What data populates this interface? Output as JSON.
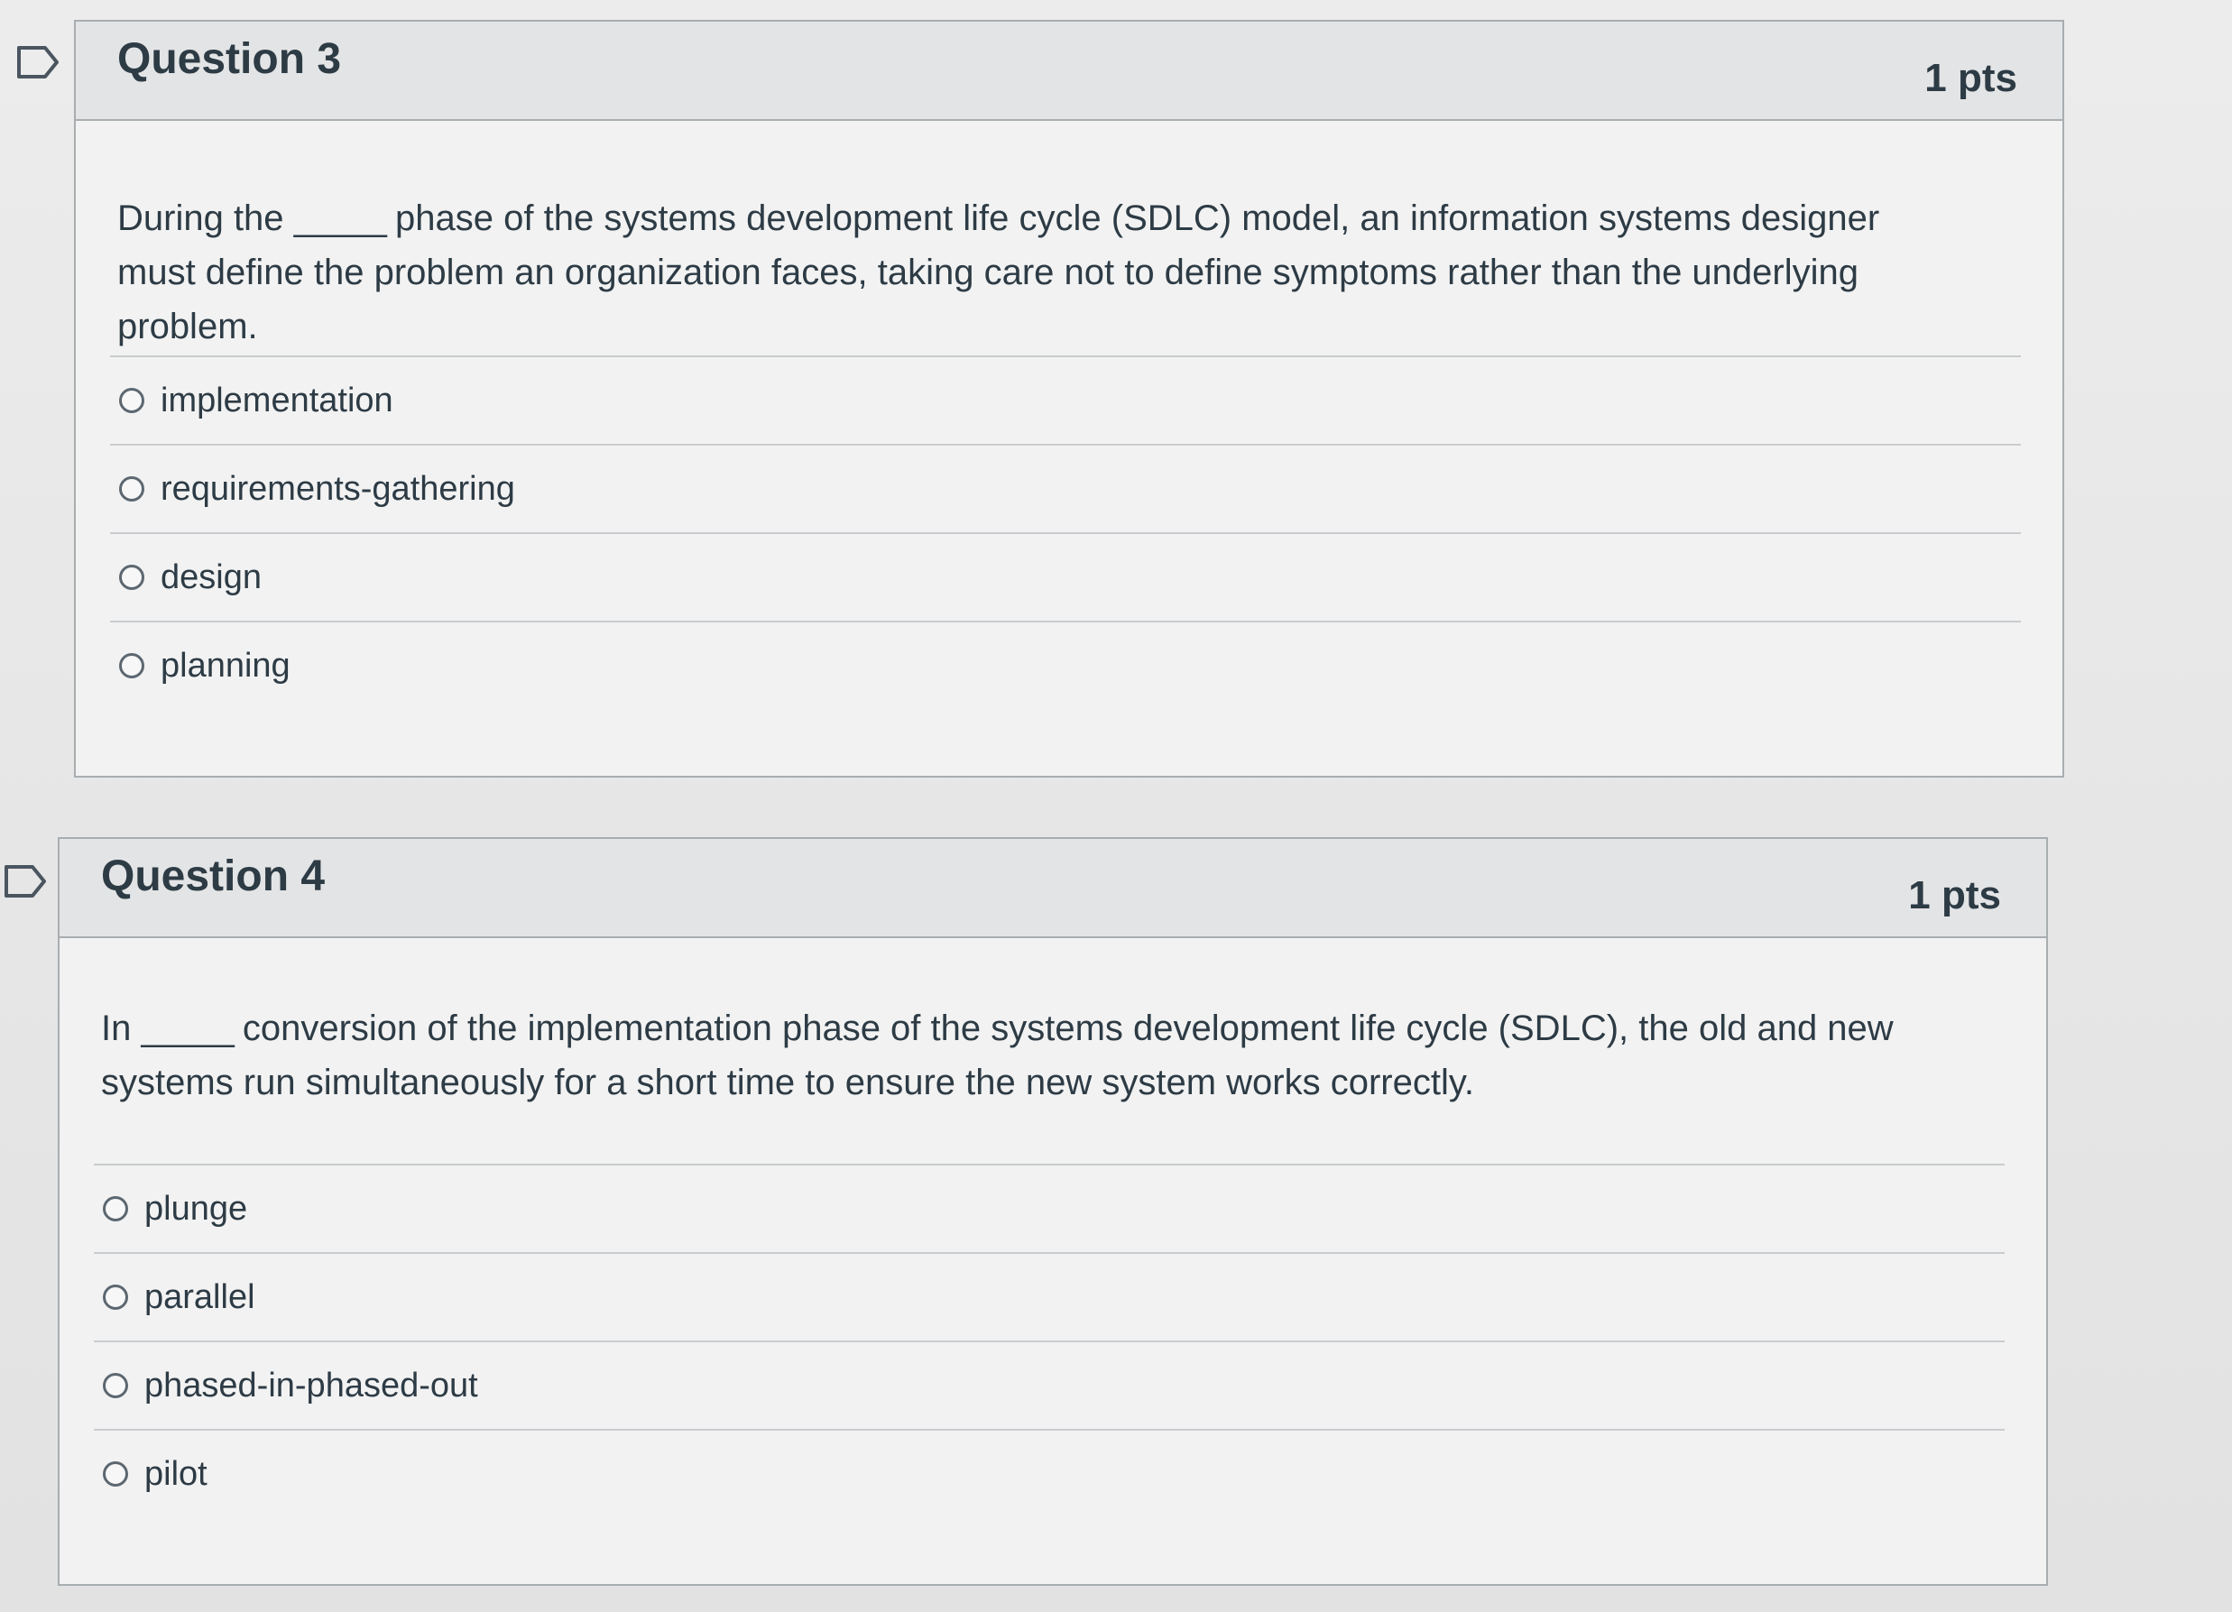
{
  "questions": [
    {
      "title": "Question 3",
      "points": "1 pts",
      "text_before": "During the",
      "blank": "_____",
      "text_after": "phase of the systems development life cycle (SDLC) model, an information systems designer must define the problem an organization faces, taking care not to define symptoms rather than the underlying problem.",
      "answers": [
        "implementation",
        "requirements-gathering",
        "design",
        "planning"
      ]
    },
    {
      "title": "Question 4",
      "points": "1 pts",
      "text_before": "In",
      "blank": "_____",
      "text_after": "conversion of the implementation phase of the systems development life cycle (SDLC), the old and new systems run simultaneously for a short time to ensure the new system works correctly.",
      "answers": [
        "plunge",
        "parallel",
        "phased-in-phased-out",
        "pilot"
      ]
    }
  ],
  "icons": {
    "flag": "flag-question-icon",
    "radio": "radio-button-icon"
  },
  "colors": {
    "text": "#2d3b45",
    "header_bg": "#e3e4e5",
    "border": "#a8adb0"
  }
}
